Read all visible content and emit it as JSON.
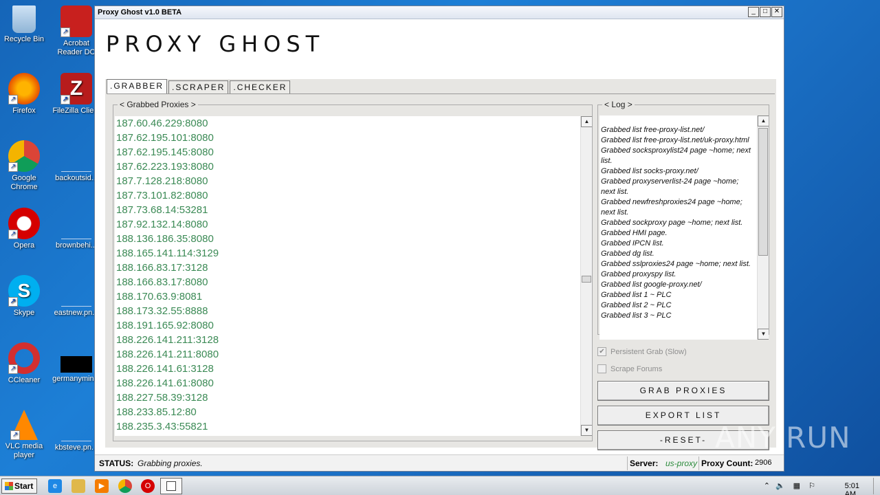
{
  "desktop": {
    "icons": [
      {
        "label": "Recycle Bin"
      },
      {
        "label": "Acrobat Reader DC"
      },
      {
        "label": "Firefox"
      },
      {
        "label": "FileZilla Client"
      },
      {
        "label": "Google Chrome"
      },
      {
        "label": "backoutsid..."
      },
      {
        "label": "Opera"
      },
      {
        "label": "brownbehi..."
      },
      {
        "label": "Skype"
      },
      {
        "label": "eastnew.pn..."
      },
      {
        "label": "CCleaner"
      },
      {
        "label": "germanymin..."
      },
      {
        "label": "VLC media player"
      },
      {
        "label": "kbsteve.pn..."
      }
    ]
  },
  "window": {
    "title": "Proxy Ghost v1.0 BETA",
    "heading": "PROXY GHOST",
    "tabs": [
      ".GRABBER",
      ".SCRAPER",
      ".CHECKER"
    ],
    "grabbed_legend": "< Grabbed Proxies >",
    "log_legend": "< Log >",
    "proxies": [
      "187.60.46.229:8080",
      "187.62.195.101:8080",
      "187.62.195.145:8080",
      "187.62.223.193:8080",
      "187.7.128.218:8080",
      "187.73.101.82:8080",
      "187.73.68.14:53281",
      "187.92.132.14:8080",
      "188.136.186.35:8080",
      "188.165.141.114:3129",
      "188.166.83.17:3128",
      "188.166.83.17:8080",
      "188.170.63.9:8081",
      "188.173.32.55:8888",
      "188.191.165.92:8080",
      "188.226.141.211:3128",
      "188.226.141.211:8080",
      "188.226.141.61:3128",
      "188.226.141.61:8080",
      "188.227.58.39:3128",
      "188.233.85.12:80",
      "188.235.3.43:55821"
    ],
    "log": [
      "Grabbed list free-proxy-list.net/",
      "Grabbed list free-proxy-list.net/uk-proxy.html",
      "Grabbed socksproxylist24 page ~home; next list.",
      "Grabbed list socks-proxy.net/",
      "Grabbed proxyserverlist-24 page ~home; next list.",
      "Grabbed newfreshproxies24 page ~home; next list.",
      "Grabbed sockproxy page ~home; next list.",
      "Grabbed HMI page.",
      "Grabbed IPCN list.",
      "Grabbed dg list.",
      "Grabbed sslproxies24 page ~home; next list.",
      "Grabbed proxyspy list.",
      "Grabbed list google-proxy.net/",
      "Grabbed list 1 ~ PLC",
      "Grabbed list 2 ~ PLC",
      "Grabbed list 3 ~ PLC"
    ],
    "persistent_grab": {
      "label": "Persistent Grab (Slow)",
      "checked": true
    },
    "scrape_forums": {
      "label": "Scrape Forums",
      "checked": false
    },
    "buttons": {
      "grab": "GRAB PROXIES",
      "export": "EXPORT LIST",
      "reset": "-RESET-"
    },
    "status": {
      "label": "STATUS:",
      "value": "Grabbing proxies.",
      "server_label": "Server:",
      "server_value": "us-proxy",
      "count_label": "Proxy Count:",
      "count_value": "2906"
    }
  },
  "watermark": "ANY RUN",
  "taskbar": {
    "start": "Start",
    "clock": "5:01 AM"
  }
}
